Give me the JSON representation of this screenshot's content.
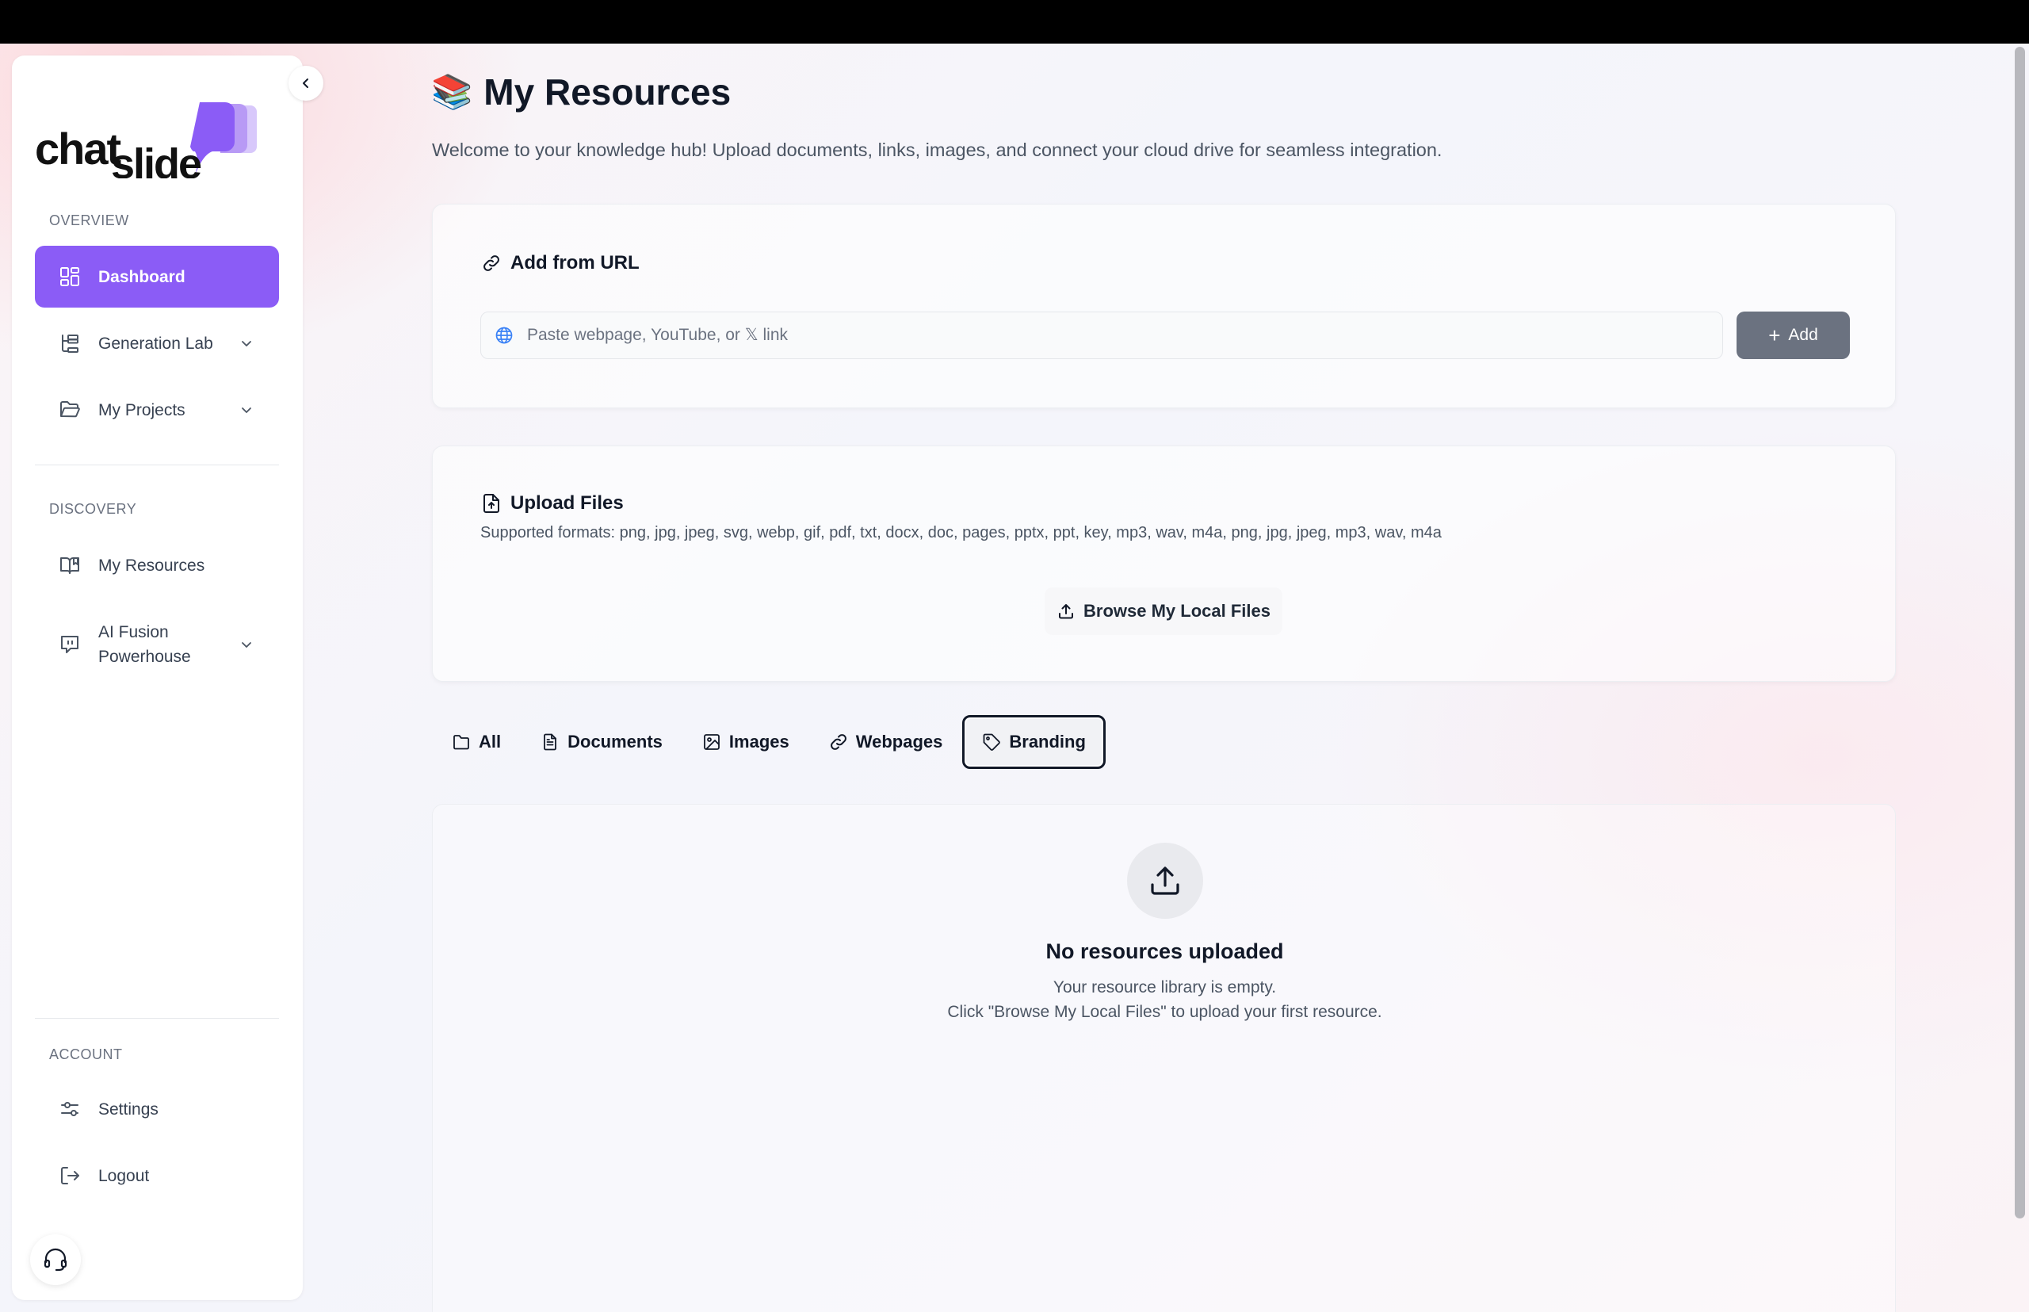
{
  "sidebar": {
    "logo_text": "chatslide",
    "sections": {
      "overview": "OVERVIEW",
      "discovery": "DISCOVERY",
      "account": "ACCOUNT"
    },
    "items": {
      "dashboard": "Dashboard",
      "generation_lab": "Generation Lab",
      "my_projects": "My Projects",
      "my_resources": "My Resources",
      "ai_fusion": "AI Fusion Powerhouse",
      "settings": "Settings",
      "logout": "Logout"
    },
    "active_item": "dashboard",
    "accent_color": "#8b5cf6"
  },
  "header": {
    "emoji": "📚",
    "title": "My Resources",
    "subtitle": "Welcome to your knowledge hub! Upload documents, links, images, and connect your cloud drive for seamless integration."
  },
  "add_url": {
    "title": "Add from URL",
    "placeholder": "Paste webpage, YouTube, or 𝕏 link",
    "value": "",
    "button_label": "Add"
  },
  "upload": {
    "title": "Upload Files",
    "formats": "Supported formats: png, jpg, jpeg, svg, webp, gif, pdf, txt, docx, doc, pages, pptx, ppt, key, mp3, wav, m4a, png, jpg, jpeg, mp3, wav, m4a",
    "browse_label": "Browse My Local Files"
  },
  "tabs": [
    {
      "label": "All",
      "icon": "folder-icon"
    },
    {
      "label": "Documents",
      "icon": "document-icon"
    },
    {
      "label": "Images",
      "icon": "image-icon"
    },
    {
      "label": "Webpages",
      "icon": "link-icon"
    },
    {
      "label": "Branding",
      "icon": "tag-icon"
    }
  ],
  "selected_tab": "Branding",
  "empty_state": {
    "title": "No resources uploaded",
    "line1": "Your resource library is empty.",
    "line2": "Click \"Browse My Local Files\" to upload your first resource."
  }
}
